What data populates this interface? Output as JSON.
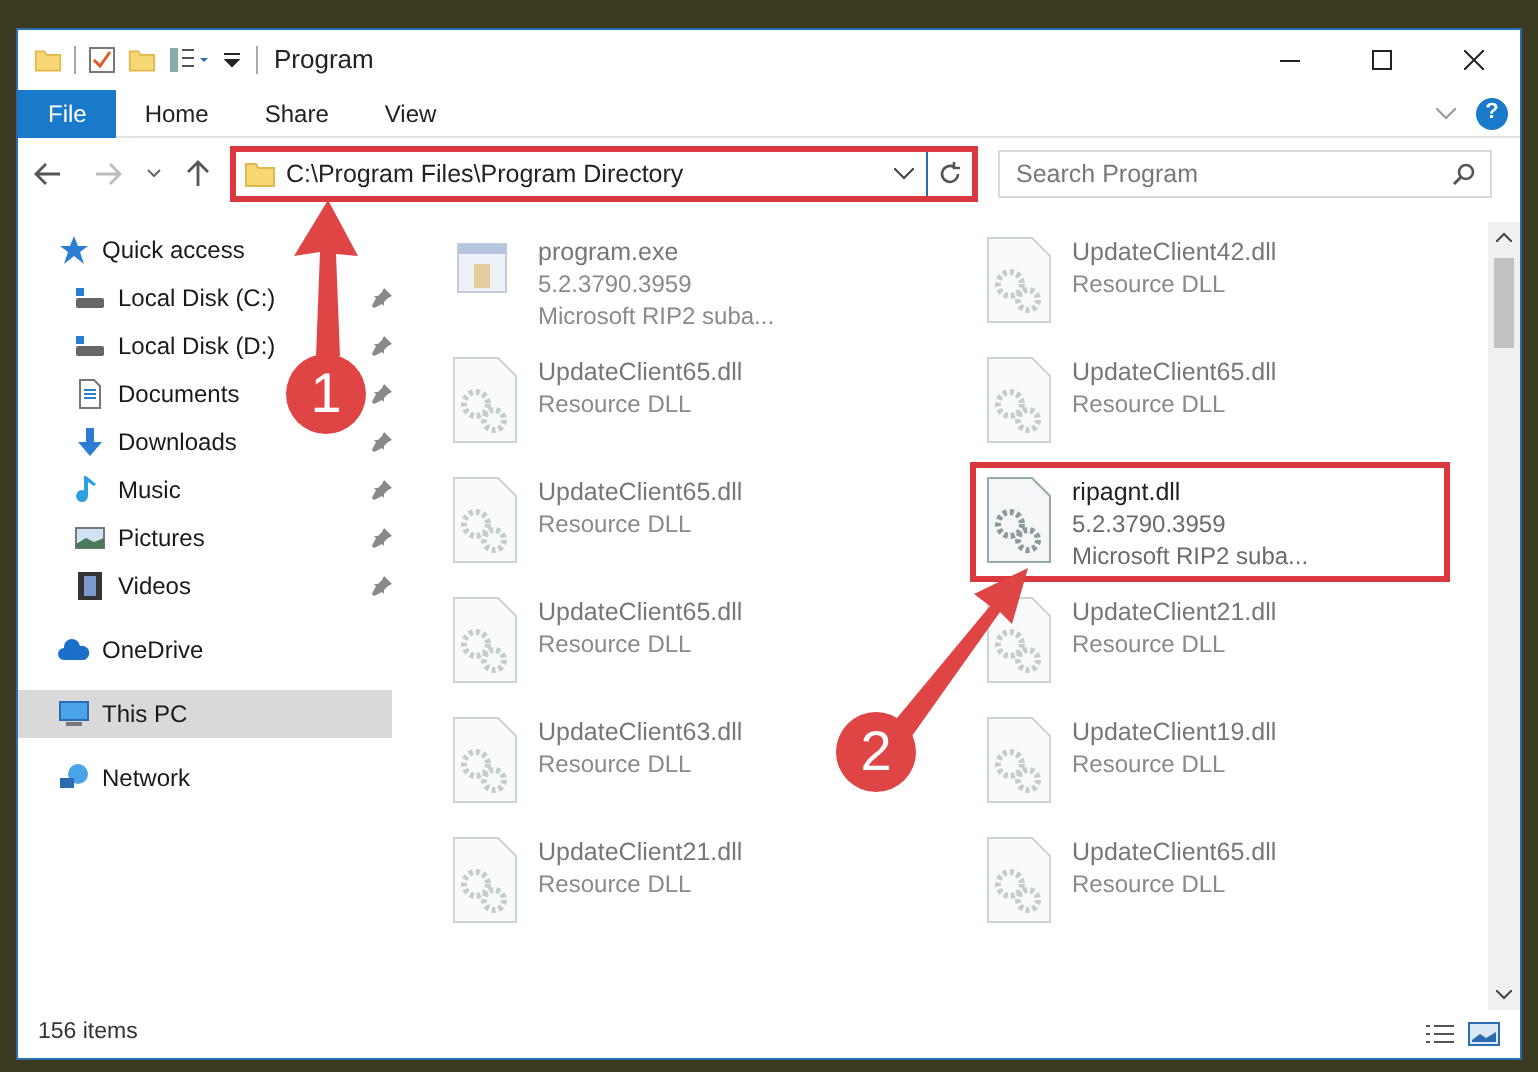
{
  "window": {
    "title": "Program"
  },
  "ribbon_tabs": [
    {
      "label": "File",
      "selected": true
    },
    {
      "label": "Home",
      "selected": false
    },
    {
      "label": "Share",
      "selected": false
    },
    {
      "label": "View",
      "selected": false
    }
  ],
  "help": {
    "label": "?"
  },
  "address_bar": {
    "value": "C:\\Program Files\\Program Directory",
    "highlighted": true
  },
  "search": {
    "placeholder": "Search Program"
  },
  "sidebar": {
    "items": [
      {
        "label": "Quick access",
        "kind": "star",
        "pinned": false,
        "selected": false,
        "children": [
          {
            "label": "Local Disk (C:)",
            "kind": "drive",
            "pinned": true,
            "selected": false
          },
          {
            "label": "Local Disk (D:)",
            "kind": "drive",
            "pinned": true,
            "selected": false
          },
          {
            "label": "Documents",
            "kind": "document",
            "pinned": true,
            "selected": false
          },
          {
            "label": "Downloads",
            "kind": "download",
            "pinned": true,
            "selected": false
          },
          {
            "label": "Music",
            "kind": "music",
            "pinned": true,
            "selected": false
          },
          {
            "label": "Pictures",
            "kind": "picture",
            "pinned": true,
            "selected": false
          },
          {
            "label": "Videos",
            "kind": "video",
            "pinned": true,
            "selected": false
          }
        ]
      },
      {
        "label": "OneDrive",
        "kind": "cloud",
        "pinned": false,
        "selected": false
      },
      {
        "label": "This PC",
        "kind": "computer",
        "pinned": false,
        "selected": true
      },
      {
        "label": "Network",
        "kind": "network",
        "pinned": false,
        "selected": false
      }
    ]
  },
  "files": [
    {
      "kind": "exe",
      "name": "program.exe",
      "lines": [
        "5.2.3790.3959",
        "Microsoft RIP2 suba..."
      ],
      "blurred": true,
      "highlighted": false
    },
    {
      "kind": "dll",
      "name": "UpdateClient42.dll",
      "lines": [
        "Resource DLL"
      ],
      "blurred": true,
      "highlighted": false
    },
    {
      "kind": "dll",
      "name": "UpdateClient65.dll",
      "lines": [
        "Resource DLL"
      ],
      "blurred": true,
      "highlighted": false
    },
    {
      "kind": "dll",
      "name": "UpdateClient65.dll",
      "lines": [
        "Resource DLL"
      ],
      "blurred": true,
      "highlighted": false
    },
    {
      "kind": "dll",
      "name": "UpdateClient65.dll",
      "lines": [
        "Resource DLL"
      ],
      "blurred": true,
      "highlighted": false
    },
    {
      "kind": "dll",
      "name": "ripagnt.dll",
      "lines": [
        "5.2.3790.3959",
        "Microsoft RIP2 suba..."
      ],
      "blurred": false,
      "highlighted": true
    },
    {
      "kind": "dll",
      "name": "UpdateClient65.dll",
      "lines": [
        "Resource DLL"
      ],
      "blurred": true,
      "highlighted": false
    },
    {
      "kind": "dll",
      "name": "UpdateClient21.dll",
      "lines": [
        "Resource DLL"
      ],
      "blurred": true,
      "highlighted": false
    },
    {
      "kind": "dll",
      "name": "UpdateClient63.dll",
      "lines": [
        "Resource DLL"
      ],
      "blurred": true,
      "highlighted": false
    },
    {
      "kind": "dll",
      "name": "UpdateClient19.dll",
      "lines": [
        "Resource DLL"
      ],
      "blurred": true,
      "highlighted": false
    },
    {
      "kind": "dll",
      "name": "UpdateClient21.dll",
      "lines": [
        "Resource DLL"
      ],
      "blurred": true,
      "highlighted": false
    },
    {
      "kind": "dll",
      "name": "UpdateClient65.dll",
      "lines": [
        "Resource DLL"
      ],
      "blurred": true,
      "highlighted": false
    }
  ],
  "status_bar": {
    "item_count": "156 items"
  },
  "callouts": [
    {
      "number": "1"
    },
    {
      "number": "2"
    }
  ]
}
